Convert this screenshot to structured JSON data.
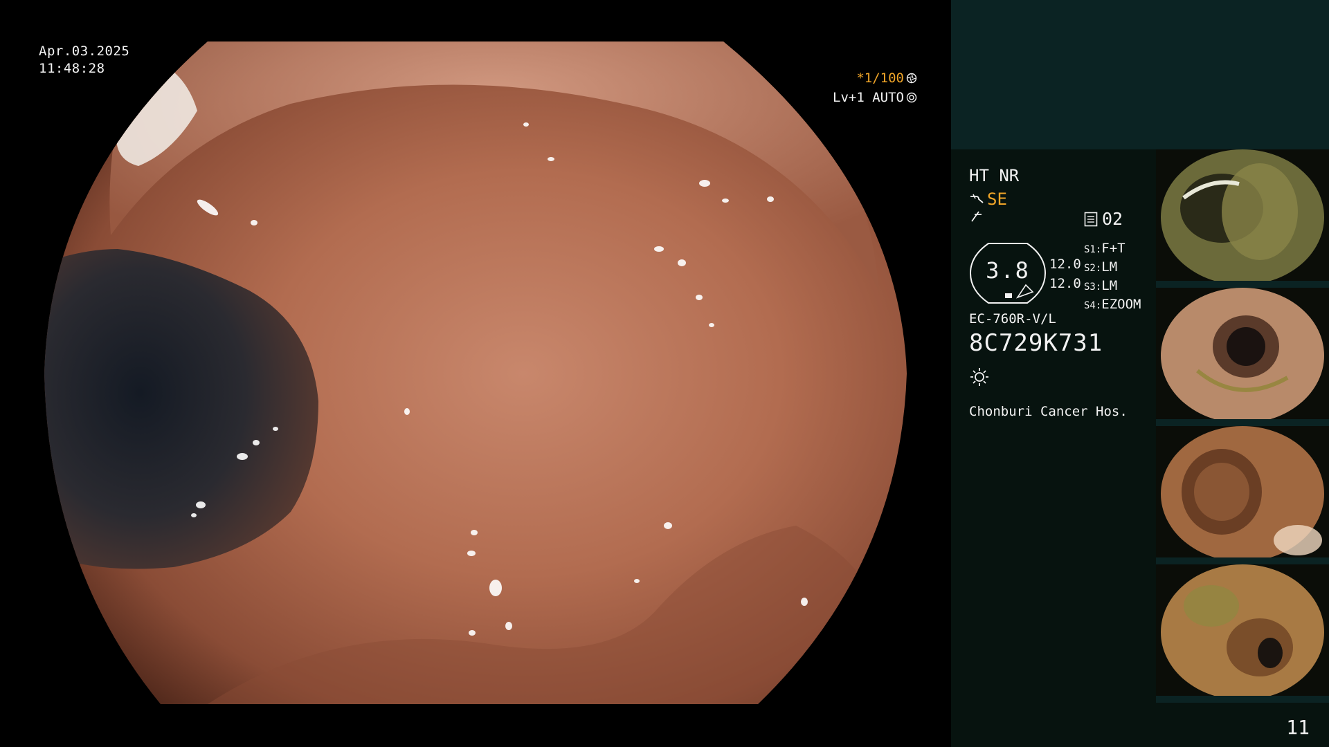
{
  "datetime": {
    "date": "Apr.03.2025",
    "time": "11:48:28"
  },
  "shutter": {
    "speed": "*1/100",
    "level": "Lv+1 AUTO"
  },
  "panel": {
    "mode": "HT NR",
    "structure_enhancement": "SE",
    "image_number": "02",
    "gauge_value": "3.8",
    "gauge_side_values": [
      "12.0",
      "12.0"
    ],
    "switches": [
      {
        "key": "S1:",
        "value": "F+T"
      },
      {
        "key": "S2:",
        "value": "LM"
      },
      {
        "key": "S3:",
        "value": "LM"
      },
      {
        "key": "S4:",
        "value": "EZOOM"
      }
    ],
    "scope_model": "EC-760R-V/L",
    "scope_serial": "8C729K731",
    "hospital": "Chonburi Cancer Hos."
  },
  "thumbnails": [
    {
      "label": "thumbnail-1"
    },
    {
      "label": "thumbnail-2"
    },
    {
      "label": "thumbnail-3"
    },
    {
      "label": "thumbnail-4"
    }
  ],
  "page_number": "11",
  "colors": {
    "accent_orange": "#f0a528",
    "panel_bg": "#07130f",
    "panel_top_bg": "#0b2323",
    "text": "#f2f2f2"
  }
}
